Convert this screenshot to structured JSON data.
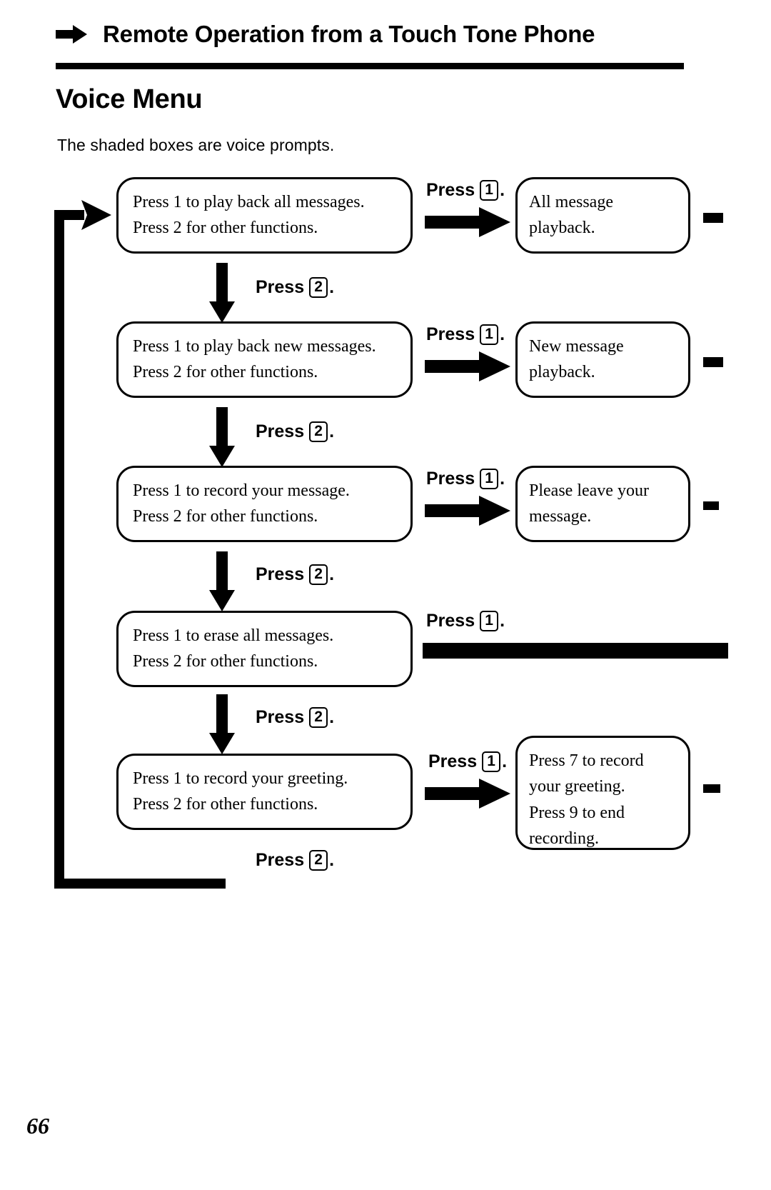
{
  "header": {
    "arrow_icon": "right-arrow-icon",
    "title": "Remote Operation from a Touch Tone Phone"
  },
  "section": {
    "title": "Voice Menu",
    "note": "The shaded boxes are voice prompts."
  },
  "flow": {
    "rows": [
      {
        "prompt_line1": "Press 1 to play back all messages.",
        "prompt_line2": "Press 2 for other functions.",
        "branch_label_word": "Press",
        "branch_label_key": "1",
        "branch_label_dot": ".",
        "result_line1": "All message",
        "result_line2": "playback.",
        "result_line3": "",
        "result_line4": "",
        "next_label_word": "Press",
        "next_label_key": "2",
        "next_label_dot": "."
      },
      {
        "prompt_line1": "Press 1 to play back new messages.",
        "prompt_line2": "Press 2 for other functions.",
        "branch_label_word": "Press",
        "branch_label_key": "1",
        "branch_label_dot": ".",
        "result_line1": "New message",
        "result_line2": "playback.",
        "result_line3": "",
        "result_line4": "",
        "next_label_word": "Press",
        "next_label_key": "2",
        "next_label_dot": "."
      },
      {
        "prompt_line1": "Press 1 to record your message.",
        "prompt_line2": "Press 2 for other functions.",
        "branch_label_word": "Press",
        "branch_label_key": "1",
        "branch_label_dot": ".",
        "result_line1": "Please leave your",
        "result_line2": "message.",
        "result_line3": "",
        "result_line4": "",
        "next_label_word": "Press",
        "next_label_key": "2",
        "next_label_dot": "."
      },
      {
        "prompt_line1": "Press 1 to erase all messages.",
        "prompt_line2": "Press 2 for other functions.",
        "branch_label_word": "Press",
        "branch_label_key": "1",
        "branch_label_dot": ".",
        "result_line1": "",
        "result_line2": "",
        "result_line3": "",
        "result_line4": "",
        "next_label_word": "Press",
        "next_label_key": "2",
        "next_label_dot": "."
      },
      {
        "prompt_line1": "Press 1 to record your greeting.",
        "prompt_line2": "Press 2 for other functions.",
        "branch_label_word": "Press",
        "branch_label_key": "1",
        "branch_label_dot": ".",
        "result_line1": "Press 7 to record",
        "result_line2": "your greeting.",
        "result_line3": "Press 9 to end",
        "result_line4": "recording.",
        "next_label_word": "Press",
        "next_label_key": "2",
        "next_label_dot": "."
      }
    ]
  },
  "footer": {
    "page_number": "66"
  },
  "colors": {
    "ink": "#000000",
    "paper": "#ffffff"
  }
}
